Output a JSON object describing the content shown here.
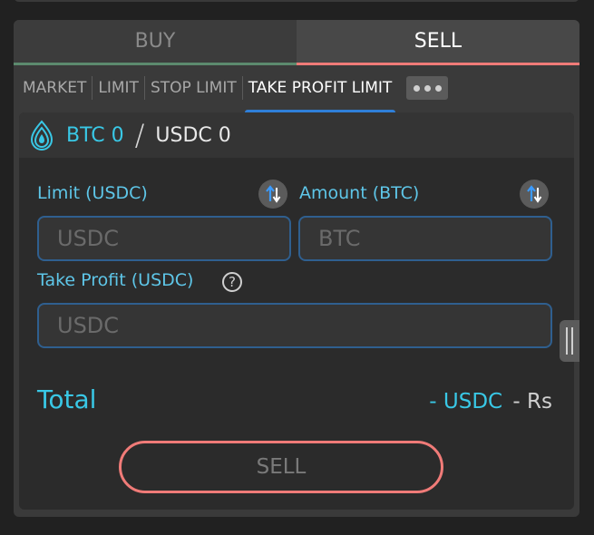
{
  "side_tabs": {
    "buy": "BUY",
    "sell": "SELL"
  },
  "order_tabs": [
    "MARKET",
    "LIMIT",
    "STOP LIMIT",
    "TAKE PROFIT LIMIT"
  ],
  "pair": {
    "base": "BTC 0",
    "separator": "/",
    "quote": "USDC 0"
  },
  "form": {
    "limit_label": "Limit (USDC)",
    "limit_placeholder": "USDC",
    "amount_label": "Amount (BTC)",
    "amount_placeholder": "BTC",
    "take_profit_label": "Take Profit (USDC)",
    "take_profit_placeholder": "USDC",
    "help_glyph": "?"
  },
  "total": {
    "label": "Total",
    "usdc": "- USDC",
    "rs": "- Rs"
  },
  "action": {
    "sell_label": "SELL"
  },
  "colors": {
    "accent": "#39c8e6",
    "sell": "#f07b78",
    "buy": "#5c8a6e",
    "active_tab": "#2f7fd8"
  }
}
